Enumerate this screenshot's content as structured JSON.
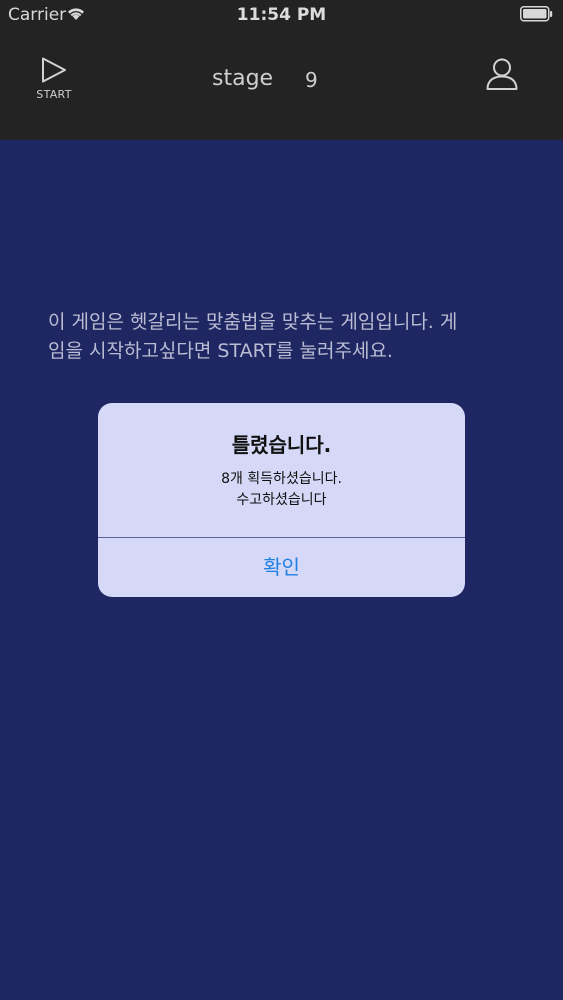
{
  "status_bar": {
    "carrier": "Carrier",
    "time": "11:54 PM"
  },
  "nav": {
    "start_label": "START",
    "stage_label": "stage",
    "stage_number": "9"
  },
  "instruction": {
    "line1": "이 게임은 헷갈리는 맞춤법을 맞추는 게임입니다. 게",
    "line2": "임을 시작하고싶다면 START를 눌러주세요."
  },
  "alert": {
    "title": "틀렸습니다.",
    "message_line1": "8개 획득하셨습니다.",
    "message_line2": "수고하셨습니다",
    "confirm_label": "확인"
  },
  "colors": {
    "background": "#1f2762",
    "bar": "#232323",
    "alert_background": "#d5d8f7",
    "confirm_text": "#1e7fe3"
  },
  "icons": {
    "wifi": "wifi-icon",
    "battery": "battery-icon",
    "start": "play-icon",
    "profile": "user-icon"
  }
}
